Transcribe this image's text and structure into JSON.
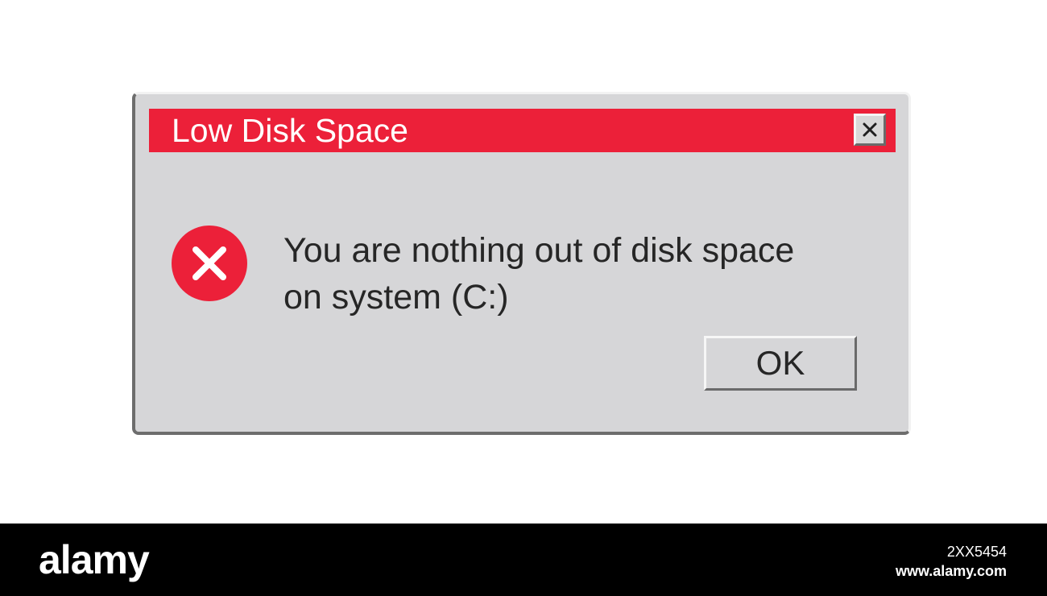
{
  "dialog": {
    "title": "Low Disk Space",
    "message_lines": [
      "You are nothing out of disk space",
      "on system (C:)"
    ],
    "ok_label": "OK",
    "close_icon": "close-icon",
    "status_icon": "error-icon"
  },
  "footer": {
    "brand": "alamy",
    "image_id": "2XX5454",
    "url": "www.alamy.com"
  },
  "colors": {
    "titlebar": "#ec2039",
    "dialog_bg": "#d6d6d8",
    "error_icon": "#ec2039",
    "text": "#262626"
  }
}
